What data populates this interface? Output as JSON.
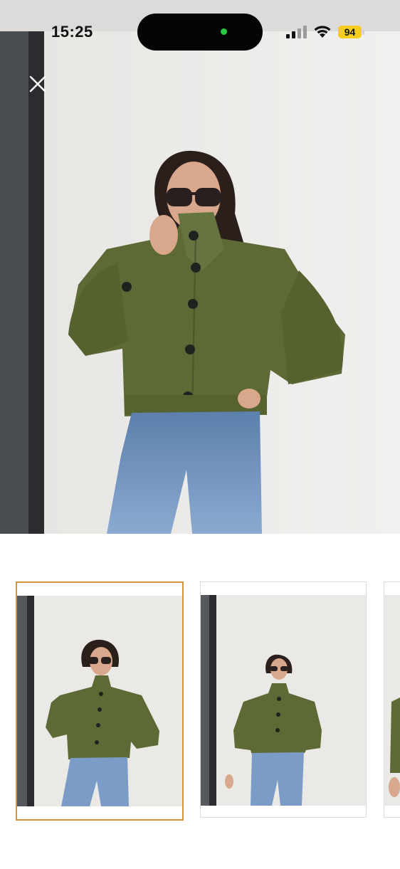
{
  "status_bar": {
    "time": "15:25",
    "battery_level": "94",
    "battery_color": "#f6cc1d",
    "island_dot_color": "#28c840"
  },
  "viewer": {
    "close_icon": "close-icon",
    "main_image": "product-photo-green-cropped-jacket"
  },
  "thumbnails": [
    {
      "image": "thumbnail-front-view",
      "selected": true
    },
    {
      "image": "thumbnail-wide-view",
      "selected": false
    },
    {
      "image": "thumbnail-partial",
      "selected": false
    }
  ],
  "colors": {
    "selected_border": "#d4913f",
    "jacket": "#5d6a36",
    "jeans": "#7a9cc6"
  }
}
